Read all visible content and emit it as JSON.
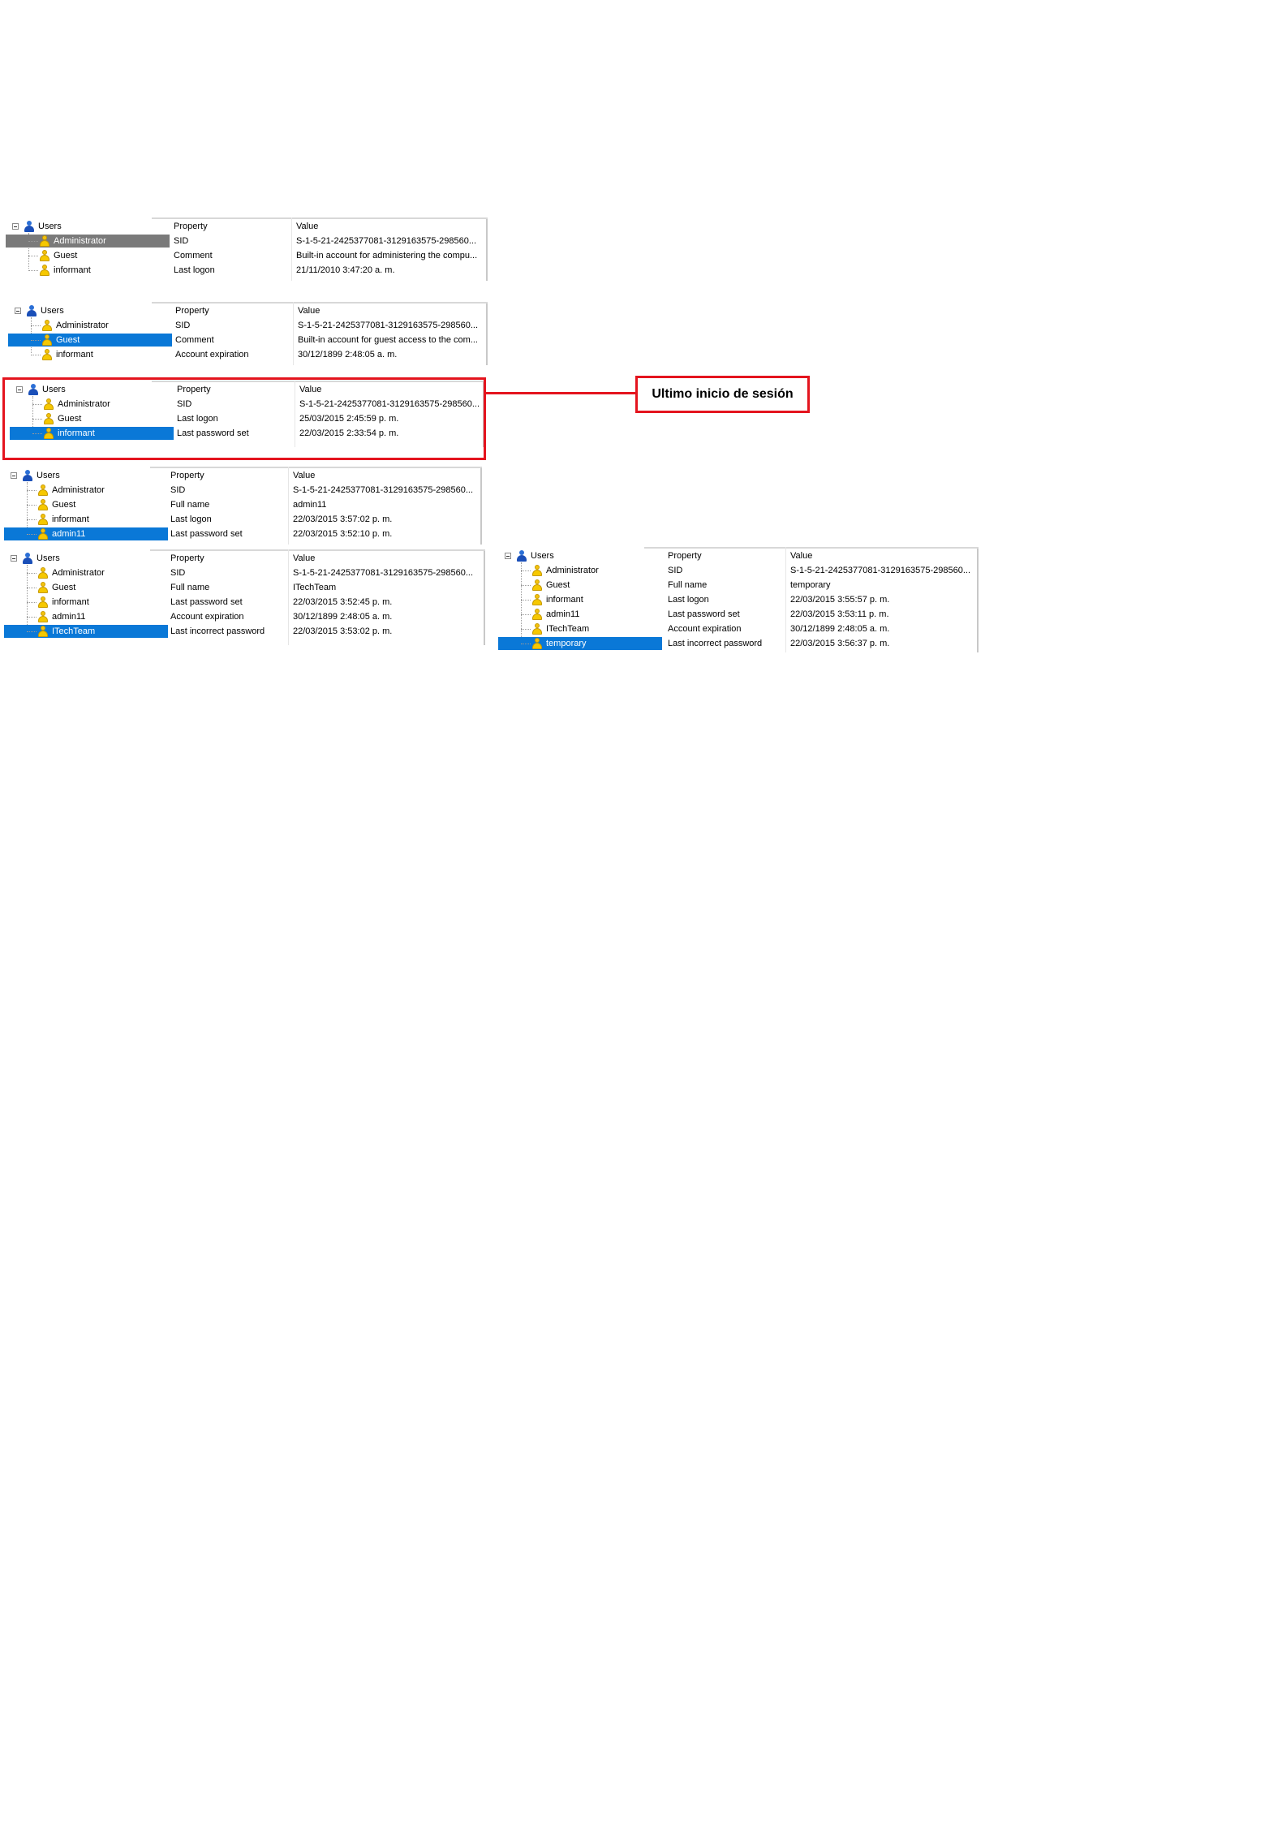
{
  "panels": [
    {
      "tree": {
        "root": "Users",
        "items": [
          "Administrator",
          "Guest",
          "informant"
        ],
        "selected": 0,
        "selection_style": "inactive"
      },
      "grid": {
        "header": {
          "property": "Property",
          "value": "Value"
        },
        "rows": [
          {
            "property": "SID",
            "value": "S-1-5-21-2425377081-3129163575-298560..."
          },
          {
            "property": "Comment",
            "value": "Built-in account for administering the compu..."
          },
          {
            "property": "Last logon",
            "value": "21/11/2010 3:47:20 a. m."
          }
        ]
      }
    },
    {
      "tree": {
        "root": "Users",
        "items": [
          "Administrator",
          "Guest",
          "informant"
        ],
        "selected": 1,
        "selection_style": "active"
      },
      "grid": {
        "header": {
          "property": "Property",
          "value": "Value"
        },
        "rows": [
          {
            "property": "SID",
            "value": "S-1-5-21-2425377081-3129163575-298560..."
          },
          {
            "property": "Comment",
            "value": "Built-in account for guest access to the com..."
          },
          {
            "property": "Account expiration",
            "value": "30/12/1899 2:48:05 a. m."
          }
        ]
      }
    },
    {
      "tree": {
        "root": "Users",
        "items": [
          "Administrator",
          "Guest",
          "informant"
        ],
        "selected": 2,
        "selection_style": "active"
      },
      "grid": {
        "header": {
          "property": "Property",
          "value": "Value"
        },
        "rows": [
          {
            "property": "SID",
            "value": "S-1-5-21-2425377081-3129163575-298560..."
          },
          {
            "property": "Last logon",
            "value": "25/03/2015 2:45:59 p. m."
          },
          {
            "property": "Last password set",
            "value": "22/03/2015 2:33:54 p. m."
          }
        ]
      }
    },
    {
      "tree": {
        "root": "Users",
        "items": [
          "Administrator",
          "Guest",
          "informant",
          "admin11"
        ],
        "selected": 3,
        "selection_style": "active"
      },
      "grid": {
        "header": {
          "property": "Property",
          "value": "Value"
        },
        "rows": [
          {
            "property": "SID",
            "value": "S-1-5-21-2425377081-3129163575-298560..."
          },
          {
            "property": "Full name",
            "value": "admin11"
          },
          {
            "property": "Last logon",
            "value": "22/03/2015 3:57:02 p. m."
          },
          {
            "property": "Last password set",
            "value": "22/03/2015 3:52:10 p. m."
          }
        ]
      }
    },
    {
      "tree": {
        "root": "Users",
        "items": [
          "Administrator",
          "Guest",
          "informant",
          "admin11",
          "ITechTeam"
        ],
        "selected": 4,
        "selection_style": "active"
      },
      "grid": {
        "header": {
          "property": "Property",
          "value": "Value"
        },
        "rows": [
          {
            "property": "SID",
            "value": "S-1-5-21-2425377081-3129163575-298560..."
          },
          {
            "property": "Full name",
            "value": "ITechTeam"
          },
          {
            "property": "Last password set",
            "value": "22/03/2015 3:52:45 p. m."
          },
          {
            "property": "Account expiration",
            "value": "30/12/1899 2:48:05 a. m."
          },
          {
            "property": "Last incorrect password",
            "value": "22/03/2015 3:53:02 p. m."
          }
        ]
      }
    },
    {
      "tree": {
        "root": "Users",
        "items": [
          "Administrator",
          "Guest",
          "informant",
          "admin11",
          "ITechTeam",
          "temporary"
        ],
        "selected": 5,
        "selection_style": "active"
      },
      "grid": {
        "header": {
          "property": "Property",
          "value": "Value"
        },
        "rows": [
          {
            "property": "SID",
            "value": "S-1-5-21-2425377081-3129163575-298560..."
          },
          {
            "property": "Full name",
            "value": "temporary"
          },
          {
            "property": "Last logon",
            "value": "22/03/2015 3:55:57 p. m."
          },
          {
            "property": "Last password set",
            "value": "22/03/2015 3:53:11 p. m."
          },
          {
            "property": "Account expiration",
            "value": "30/12/1899 2:48:05 a. m."
          },
          {
            "property": "Last incorrect password",
            "value": "22/03/2015 3:56:37 p. m."
          }
        ]
      }
    }
  ],
  "callout": {
    "label": "Ultimo inicio de sesión",
    "color": "#e4141e",
    "target_panel": 2
  },
  "colors": {
    "selection": "#0a78d7",
    "inactive_selection": "#7a7a7a",
    "callout": "#e4141e"
  }
}
